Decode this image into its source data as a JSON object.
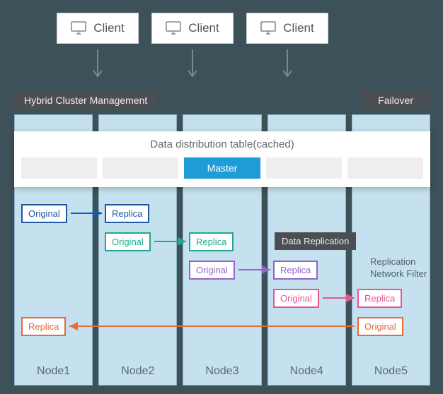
{
  "clients": [
    {
      "label": "Client"
    },
    {
      "label": "Client"
    },
    {
      "label": "Client"
    }
  ],
  "labels": {
    "hybrid_cluster_management": "Hybrid Cluster Management",
    "failover": "Failover",
    "data_distribution_title": "Data distribution table(cached)",
    "master": "Master",
    "data_replication": "Data Replication",
    "side_note_line1": "Replication",
    "side_note_line2": "Network Filter"
  },
  "nodes": [
    {
      "name": "Node1"
    },
    {
      "name": "Node2"
    },
    {
      "name": "Node3"
    },
    {
      "name": "Node4"
    },
    {
      "name": "Node5"
    }
  ],
  "pairs": [
    {
      "from_node": 1,
      "to_node": 2,
      "color": "#1d5aa0",
      "original": "Original",
      "replica": "Replica"
    },
    {
      "from_node": 2,
      "to_node": 3,
      "color": "#1fa98c",
      "original": "Original",
      "replica": "Replica"
    },
    {
      "from_node": 3,
      "to_node": 4,
      "color": "#9862c7",
      "original": "Original",
      "replica": "Replica"
    },
    {
      "from_node": 4,
      "to_node": 5,
      "color": "#e85594",
      "original": "Original",
      "replica": "Replica"
    },
    {
      "from_node": 5,
      "to_node": 1,
      "color": "#e86b3a",
      "original": "Original",
      "replica": "Replica"
    }
  ],
  "colors": {
    "bg": "#3d5158",
    "node_bg": "#c5e0ee",
    "master": "#1e9cd6",
    "label_pill": "#4b4f53"
  }
}
